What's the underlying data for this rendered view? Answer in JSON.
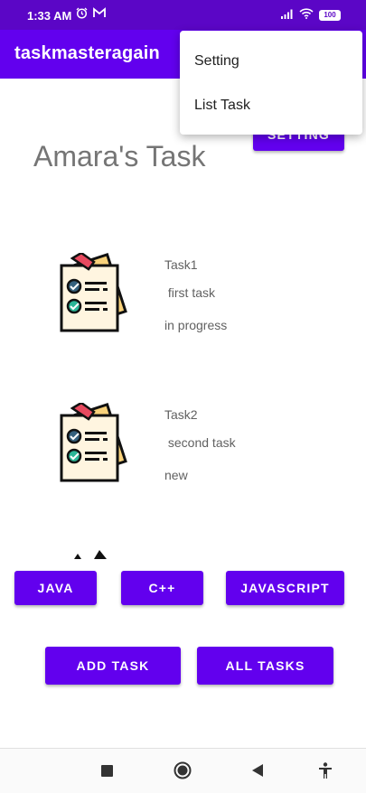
{
  "status_bar": {
    "time": "1:33 AM",
    "battery": "100"
  },
  "app_bar": {
    "title": "taskmasteragain"
  },
  "menu": {
    "items": [
      "Setting",
      "List Task"
    ]
  },
  "setting_button": "SETTING",
  "heading": "Amara's Task",
  "tasks": [
    {
      "title": "Task1",
      "body": " first task",
      "state": "in progress"
    },
    {
      "title": "Task2",
      "body": " second task",
      "state": "new"
    }
  ],
  "filters": [
    "JAVA",
    "C++",
    "JAVASCRIPT"
  ],
  "actions": {
    "add": "ADD TASK",
    "all": "ALL TASKS"
  },
  "colors": {
    "primary": "#6200ee",
    "status_bar": "#5b06c6"
  }
}
